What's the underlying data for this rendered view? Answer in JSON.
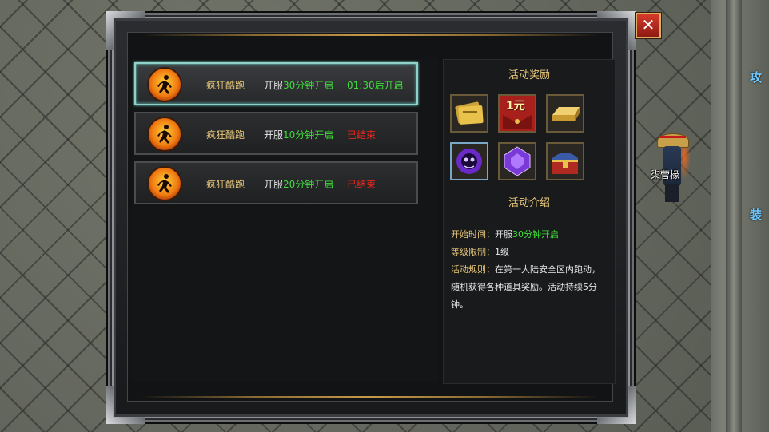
{
  "scene": {
    "side_labels": [
      "攻",
      "装"
    ],
    "hero_name": "柒菅椽"
  },
  "close_label": "✕",
  "activities": [
    {
      "name": "疯狂酷跑",
      "open_prefix": "开服",
      "open_time": "30分钟开启",
      "status": "01:30后开启",
      "status_color": "green",
      "selected": true
    },
    {
      "name": "疯狂酷跑",
      "open_prefix": "开服",
      "open_time": "10分钟开启",
      "status": "已结束",
      "status_color": "red",
      "selected": false
    },
    {
      "name": "疯狂酷跑",
      "open_prefix": "开服",
      "open_time": "20分钟开启",
      "status": "已结束",
      "status_color": "red",
      "selected": false
    }
  ],
  "panel": {
    "rewards_title": "活动奖励",
    "rewards": [
      {
        "icon": "gold-tickets-icon"
      },
      {
        "icon": "red-envelope-icon",
        "label": "1元"
      },
      {
        "icon": "gold-bar-icon"
      },
      {
        "icon": "purple-soul-orb-icon"
      },
      {
        "icon": "purple-gem-icon"
      },
      {
        "icon": "treasure-chest-icon"
      }
    ],
    "intro_title": "活动介绍",
    "start_label": "开始时间：",
    "start_prefix": "开服",
    "start_time": "30分钟开启",
    "level_label": "等级限制：",
    "level_value": "1级",
    "rules_label": "活动规则：",
    "rules_text": "在第一大陆安全区内跑动，随机获得各种道具奖励。活动持续5分钟。"
  },
  "colors": {
    "gold_text": "#e8c77a",
    "green_text": "#3fdc3a",
    "red_text": "#e8261c",
    "selected_border": "#8fd0c8"
  }
}
